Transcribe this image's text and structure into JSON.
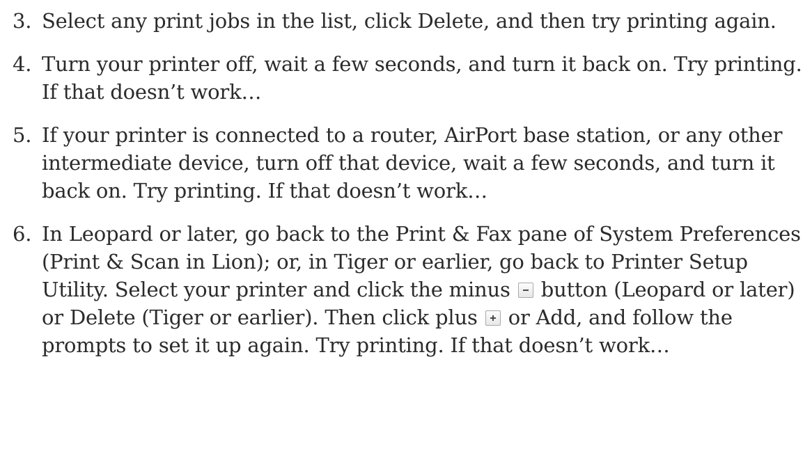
{
  "steps": [
    {
      "number": "3.",
      "text": "Select any print jobs in the list, click Delete, and then try printing again."
    },
    {
      "number": "4.",
      "text": "Turn your printer off, wait a few seconds, and turn it back on. Try printing. If that doesn’t work…"
    },
    {
      "number": "5.",
      "text": "If your printer is connected to a router, AirPort base station, or any other intermediate device, turn off that device, wait a few seconds, and turn it back on. Try printing. If that doesn’t work…"
    },
    {
      "number": "6.",
      "text_a": "In Leopard or later, go back to the Print & Fax pane of System Preferences (Print & Scan in Lion); or, in Tiger or earlier, go back to Printer Setup Utility. Select your printer and click the minus",
      "text_b": "button (Leopard or later) or Delete (Tiger or earlier). Then click plus",
      "text_c": "or Add, and follow the prompts to set it up again. Try printing. If that doesn’t work…",
      "icons": [
        "minus-button-icon",
        "plus-button-icon"
      ]
    }
  ]
}
